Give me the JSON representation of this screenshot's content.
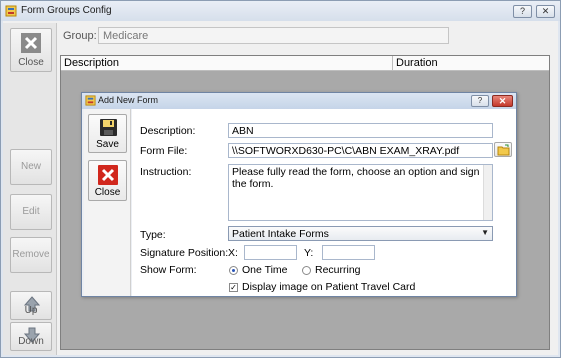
{
  "window": {
    "title": "Form Groups Config",
    "help_label": "?",
    "close_label": "✕"
  },
  "sidebar": {
    "close_label": "Close",
    "new_label": "New",
    "edit_label": "Edit",
    "remove_label": "Remove",
    "up_label": "Up",
    "down_label": "Down"
  },
  "group": {
    "label": "Group:",
    "value": "Medicare"
  },
  "grid": {
    "columns": [
      "Description",
      "Duration"
    ]
  },
  "dialog": {
    "title": "Add New Form",
    "help_label": "?",
    "close_label": "✕",
    "save_label": "Save",
    "close_button_label": "Close",
    "description_label": "Description:",
    "description_value": "ABN",
    "form_file_label": "Form File:",
    "form_file_value": "\\\\SOFTWORXD630-PC\\C\\ABN EXAM_XRAY.pdf",
    "instruction_label": "Instruction:",
    "instruction_value": "Please fully read the form, choose an option and sign the form.",
    "type_label": "Type:",
    "type_value": "Patient Intake Forms",
    "signature_position_label": "Signature Position:",
    "x_label": "X:",
    "x_value": "",
    "y_label": "Y:",
    "y_value": "",
    "show_form_label": "Show Form:",
    "show_form_options": [
      "One Time",
      "Recurring"
    ],
    "show_form_selected": "One Time",
    "display_image_label": "Display image on Patient Travel Card",
    "display_image_checked": true
  }
}
